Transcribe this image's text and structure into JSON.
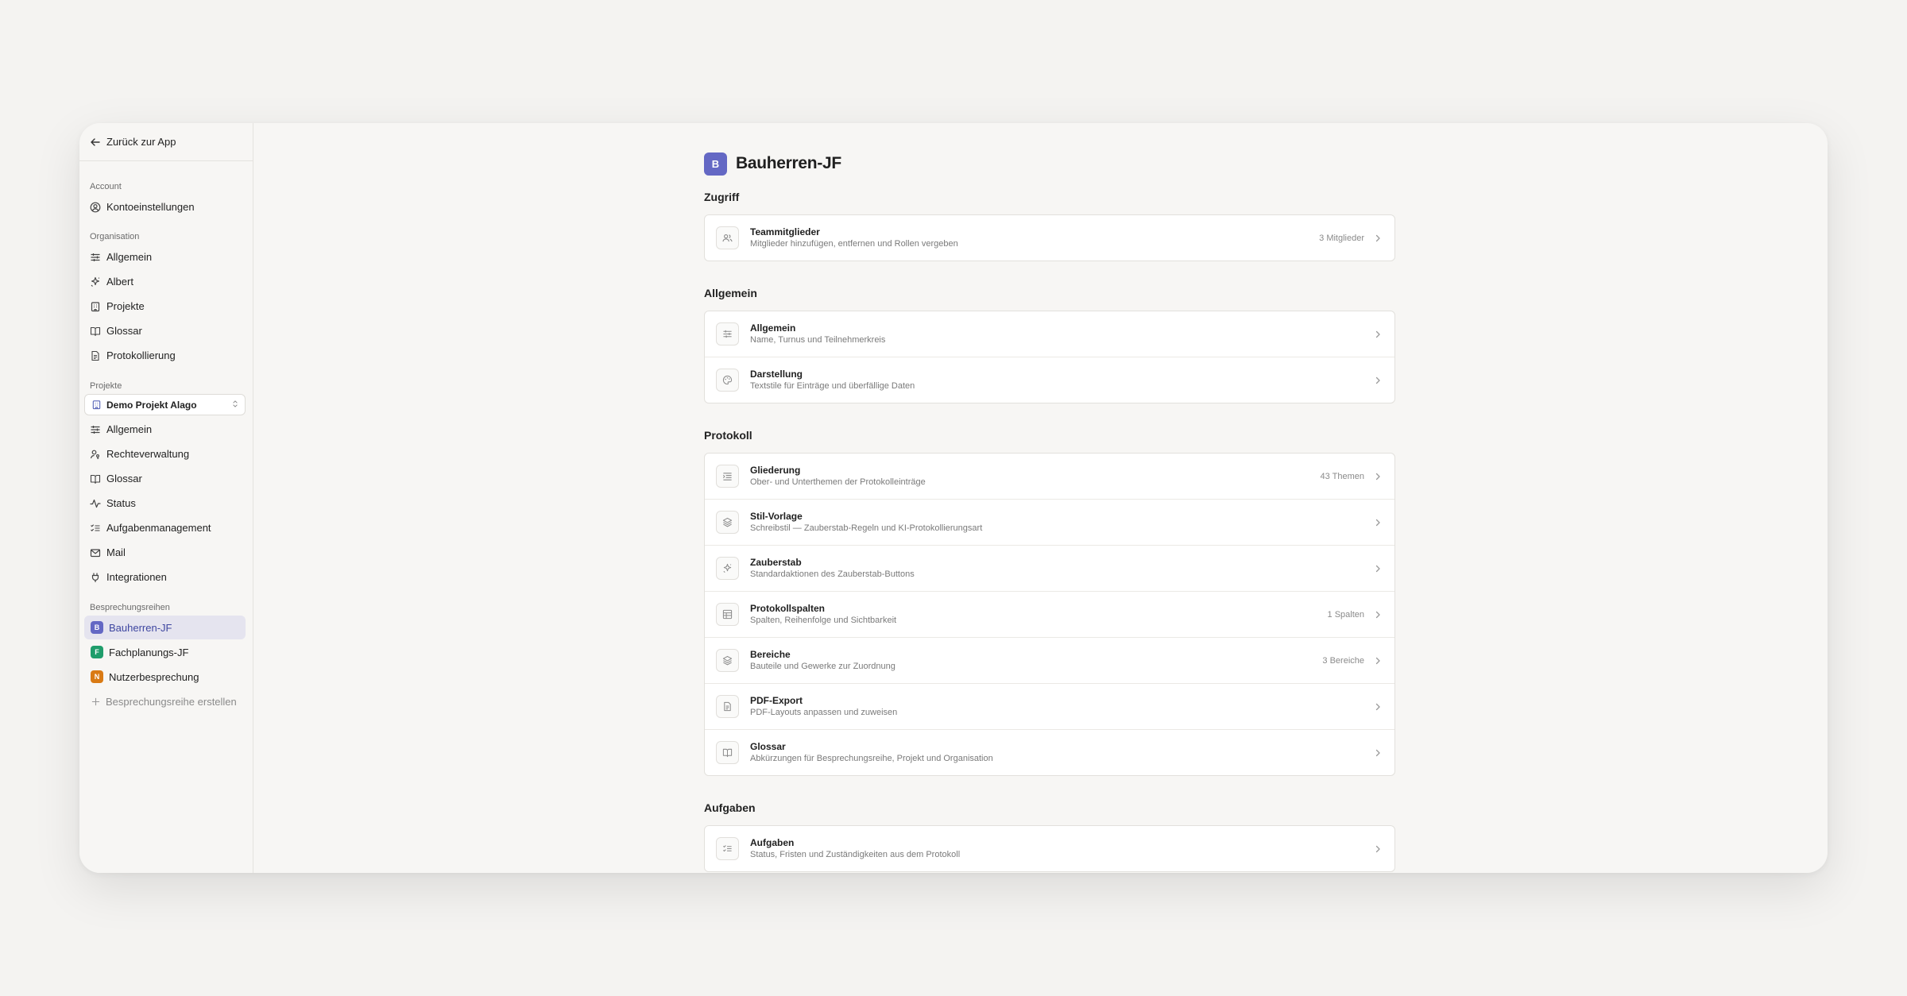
{
  "sidebar": {
    "back_label": "Zurück zur App",
    "account_label": "Account",
    "account_items": [
      {
        "label": "Kontoeinstellungen",
        "icon": "user-circle-icon"
      }
    ],
    "organisation_label": "Organisation",
    "organisation_items": [
      {
        "label": "Allgemein",
        "icon": "sliders-icon"
      },
      {
        "label": "Albert",
        "icon": "sparkle-icon"
      },
      {
        "label": "Projekte",
        "icon": "building-icon"
      },
      {
        "label": "Glossar",
        "icon": "book-icon"
      },
      {
        "label": "Protokollierung",
        "icon": "document-icon"
      }
    ],
    "projects_label": "Projekte",
    "project_select": "Demo Projekt Alago",
    "project_items": [
      {
        "label": "Allgemein",
        "icon": "sliders-icon"
      },
      {
        "label": "Rechteverwaltung",
        "icon": "user-key-icon"
      },
      {
        "label": "Glossar",
        "icon": "book-icon"
      },
      {
        "label": "Status",
        "icon": "activity-icon"
      },
      {
        "label": "Aufgabenmanagement",
        "icon": "checklist-icon"
      },
      {
        "label": "Mail",
        "icon": "mail-icon"
      },
      {
        "label": "Integrationen",
        "icon": "plug-icon"
      }
    ],
    "series_label": "Besprechungsreihen",
    "series_items": [
      {
        "letter": "B",
        "label": "Bauherren-JF",
        "color": "#6468c4",
        "active": true
      },
      {
        "letter": "F",
        "label": "Fachplanungs-JF",
        "color": "#1f9d6b",
        "active": false
      },
      {
        "letter": "N",
        "label": "Nutzerbesprechung",
        "color": "#d97a14",
        "active": false
      }
    ],
    "create_label": "Besprechungsreihe erstellen"
  },
  "main": {
    "badge_letter": "B",
    "title": "Bauherren-JF",
    "groups": [
      {
        "title": "Zugriff",
        "rows": [
          {
            "title": "Teammitglieder",
            "subtitle": "Mitglieder hinzufügen, entfernen und Rollen vergeben",
            "meta": "3 Mitglieder",
            "icon": "users-icon"
          }
        ]
      },
      {
        "title": "Allgemein",
        "rows": [
          {
            "title": "Allgemein",
            "subtitle": "Name, Turnus und Teilnehmerkreis",
            "meta": "",
            "icon": "sliders-icon"
          },
          {
            "title": "Darstellung",
            "subtitle": "Textstile für Einträge und überfällige Daten",
            "meta": "",
            "icon": "palette-icon"
          }
        ]
      },
      {
        "title": "Protokoll",
        "rows": [
          {
            "title": "Gliederung",
            "subtitle": "Ober- und Unterthemen der Protokolleinträge",
            "meta": "43 Themen",
            "icon": "list-indent-icon"
          },
          {
            "title": "Stil-Vorlage",
            "subtitle": "Schreibstil — Zauberstab-Regeln und KI-Protokollierungsart",
            "meta": "",
            "icon": "layers-icon"
          },
          {
            "title": "Zauberstab",
            "subtitle": "Standardaktionen des Zauberstab-Buttons",
            "meta": "",
            "icon": "sparkle-icon"
          },
          {
            "title": "Protokollspalten",
            "subtitle": "Spalten, Reihenfolge und Sichtbarkeit",
            "meta": "1 Spalten",
            "icon": "table-icon"
          },
          {
            "title": "Bereiche",
            "subtitle": "Bauteile und Gewerke zur Zuordnung",
            "meta": "3 Bereiche",
            "icon": "layers-icon"
          },
          {
            "title": "PDF-Export",
            "subtitle": "PDF-Layouts anpassen und zuweisen",
            "meta": "",
            "icon": "document-icon"
          },
          {
            "title": "Glossar",
            "subtitle": "Abkürzungen für Besprechungsreihe, Projekt und Organisation",
            "meta": "",
            "icon": "book-icon"
          }
        ]
      },
      {
        "title": "Aufgaben",
        "rows": [
          {
            "title": "Aufgaben",
            "subtitle": "Status, Fristen und Zuständigkeiten aus dem Protokoll",
            "meta": "",
            "icon": "checklist-icon"
          }
        ]
      }
    ]
  }
}
